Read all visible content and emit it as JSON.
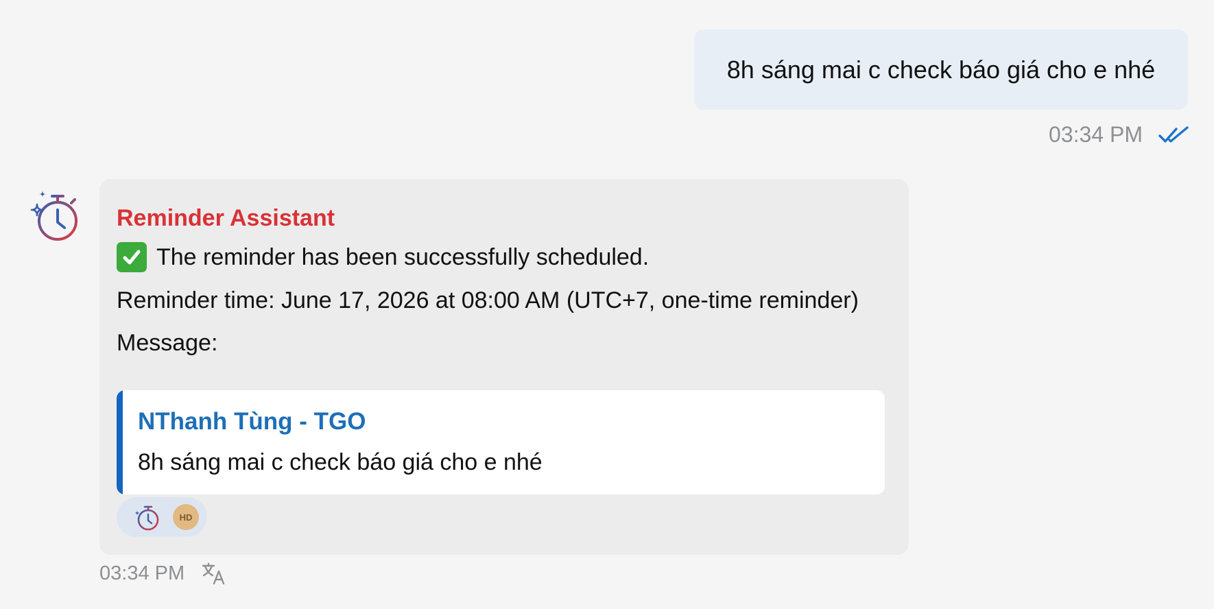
{
  "outgoing": {
    "text": "8h sáng mai c check báo giá cho e nhé",
    "time": "03:34 PM",
    "status_icon": "double-check-icon"
  },
  "incoming": {
    "avatar_icon": "stopwatch-sparkle-icon",
    "sender": "Reminder Assistant",
    "status_line": "The reminder has been successfully scheduled.",
    "status_emoji": "check-mark-emoji",
    "reminder_time": "Reminder time: June 17, 2026 at 08:00 AM (UTC+7, one-time reminder)",
    "message_label": "Message:",
    "quote": {
      "author": "NThanh Tùng - TGO",
      "text": "8h sáng mai c check báo giá cho e nhé"
    },
    "reactions": {
      "icon": "stopwatch-sparkle-icon",
      "badge": "HD"
    },
    "time": "03:34 PM",
    "translate_icon": "translate-icon"
  },
  "colors": {
    "background": "#f5f5f6",
    "outgoing_bubble": "#e7eef6",
    "incoming_card": "#ececed",
    "sender": "#d93236",
    "quote_accent": "#1565c0",
    "quote_author": "#1d6fb8",
    "tick": "#1e73c8"
  }
}
